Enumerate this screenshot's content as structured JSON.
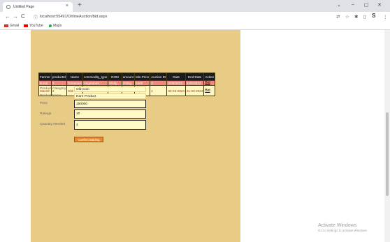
{
  "browser": {
    "tab_title": "Untitled Page",
    "tab_close": "×",
    "new_tab": "+",
    "window_controls": [
      "⌄",
      "–",
      "▢",
      "✕"
    ],
    "url": "localhost:55491/OnlineAuction/bid.aspx",
    "nav": {
      "back": "←",
      "forward": "→",
      "reload": "C"
    },
    "right_tools": [
      "⇄",
      "☆",
      "✱",
      "▯",
      "S",
      "⋮"
    ],
    "bookmarks": [
      {
        "label": "Gmail",
        "icon": "gmail-icon",
        "color": "#d93025"
      },
      {
        "label": "YouTube",
        "icon": "youtube-icon",
        "color": "#ff0000"
      },
      {
        "label": "Maps",
        "icon": "maps-icon",
        "color": "#34a853"
      }
    ]
  },
  "table": {
    "headers": [
      "Farmer",
      "productId",
      "Name",
      "commodity_type",
      "DOM",
      "amount",
      "Min.Price",
      "Auction ID",
      "Date",
      "End Date",
      "Action"
    ],
    "rows": [
      [
        "kunal",
        "3",
        "Tomatoes",
        "Vegetables",
        "5/4kg",
        "200kg",
        "1500",
        "3",
        "20/5/2023",
        "22/5/2023",
        "Bid"
      ],
      [
        "Manish",
        "2",
        "Old Coin",
        "Rare Product",
        "",
        "Bitecoin",
        "20",
        "10000",
        "4",
        "30-03-2023",
        "31-03-2023",
        "Bid"
      ]
    ]
  },
  "form": {
    "category_label": "Product Category",
    "category_value": "Old Coin",
    "name_label": "Product Name",
    "name_value": "Rare Product",
    "price_label": "Price",
    "price_value": "150000",
    "ratings_label": "Ratings",
    "ratings_value": "10",
    "quantity_label": "Quantity Needed",
    "quantity_value": "4",
    "confirm_label": "Confirm Bidding"
  },
  "windows_watermark": {
    "line1": "Activate Windows",
    "line2": "Go to Settings to activate Windows."
  },
  "colors": {
    "page_background": "#e8cc86",
    "table_header": "#1b1b1b",
    "row_highlight": "#f08a80",
    "button": "#e58a2a"
  }
}
